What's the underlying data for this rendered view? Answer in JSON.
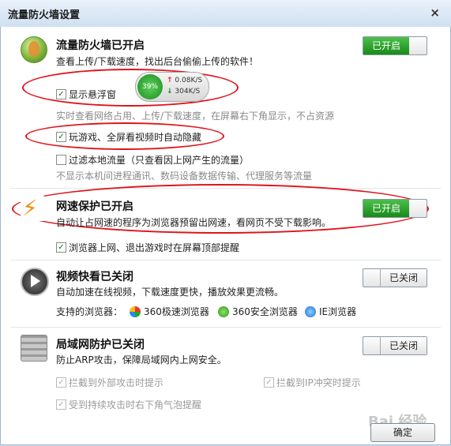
{
  "window": {
    "title": "流量防火墙设置",
    "close_glyph": "×"
  },
  "firewall": {
    "title": "流量防火墙已开启",
    "desc": "查看上传/下载速度，找出后台偷偷上传的软件！",
    "toggle": "已开启",
    "show_float_label": "显示悬浮窗",
    "float_desc": "实时查看网络占用、上传/下载速度，在屏幕右下角显示，不占资源",
    "game_hide_label": "玩游戏、全屏看视频时自动隐藏",
    "filter_local_label": "过滤本地流量（只查看因上网产生的流量）",
    "filter_local_desc": "不显示本机间进程通讯、数码设备数据传输、代理服务等流量",
    "meter": {
      "percent": "39%",
      "up": "0.08K/S",
      "down": "304K/S"
    }
  },
  "speed": {
    "title": "网速保护已开启",
    "desc": "自动让占网速的程序为浏览器预留出网速，看网页不受下载影响。",
    "toggle": "已开启",
    "remind_label": "浏览器上网、退出游戏时在屏幕顶部提醒"
  },
  "video": {
    "title": "视频快看已关闭",
    "desc": "自动加速在线视频，下载速度更快，播放效果更流畅。",
    "toggle": "已关闭",
    "browsers_label": "支持的浏览器：",
    "browsers": [
      "360极速浏览器",
      "360安全浏览器",
      "IE浏览器"
    ]
  },
  "lan": {
    "title": "局域网防护已关闭",
    "desc": "防止ARP攻击，保障局域网内上网安全。",
    "toggle": "已关闭",
    "block_external": "拦截到外部攻击时提示",
    "block_ip": "拦截到IP冲突时提示",
    "continuous": "受到持续攻击时右下角气泡提醒"
  },
  "footer": {
    "ok": "确定",
    "watermark": "Bai 经验"
  },
  "check_glyph": "✓",
  "icons": {
    "firewall": "shield-fire-icon",
    "speed": "speed-protect-icon",
    "video": "video-play-icon",
    "lan": "brick-wall-icon"
  },
  "colors": {
    "toggle_on": "#1f951f",
    "annotation": "#e0141c"
  }
}
